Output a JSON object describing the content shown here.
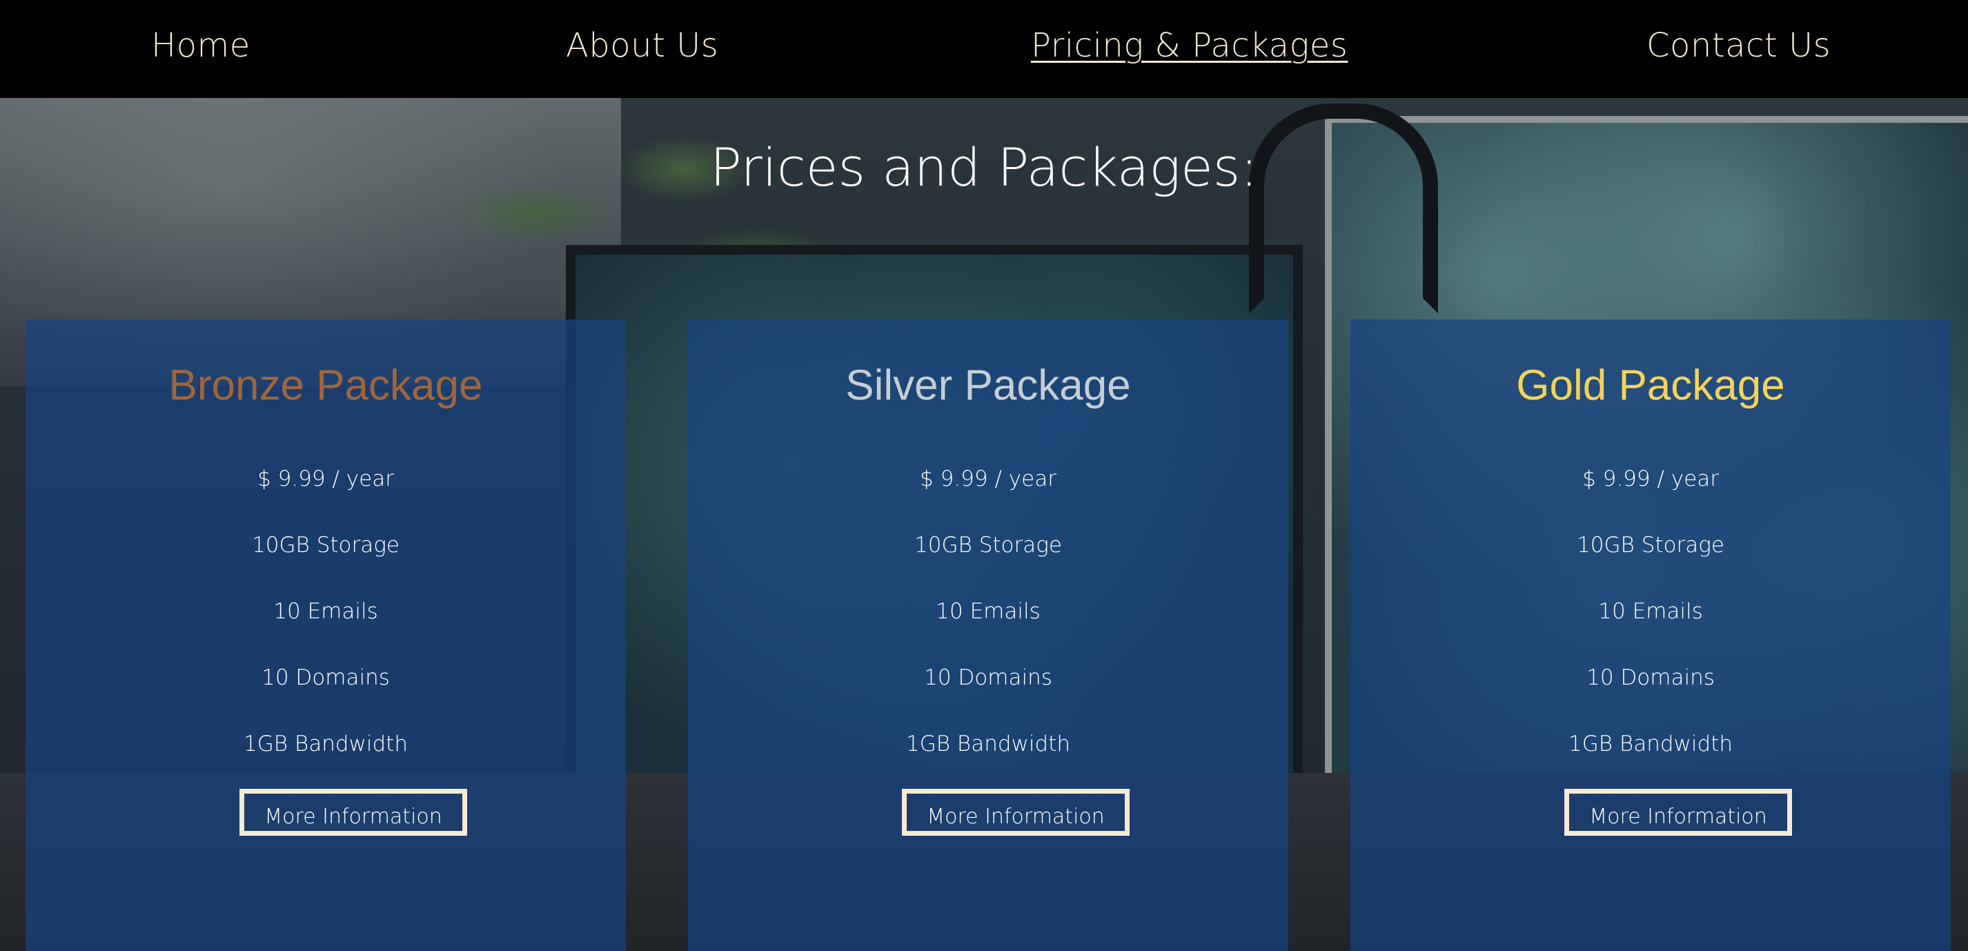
{
  "nav": {
    "items": [
      {
        "label": "Home",
        "active": false
      },
      {
        "label": "About Us",
        "active": false
      },
      {
        "label": "Pricing & Packages",
        "active": true
      },
      {
        "label": "Contact Us",
        "active": false
      }
    ]
  },
  "page": {
    "title": "Prices and Packages:"
  },
  "colors": {
    "nav_text": "#f7ead4",
    "card_bg": "rgba(24,66,130,0.72)",
    "bronze": "#a0663a",
    "silver": "#c7cdd4",
    "gold": "#f3d35a",
    "button_border": "#f7ead4"
  },
  "packages": [
    {
      "name": "Bronze Package",
      "price": "$ 9.99 / year",
      "storage": "10GB Storage",
      "emails": "10 Emails",
      "domains": "10 Domains",
      "bandwidth": "1GB Bandwidth",
      "button": "More Information"
    },
    {
      "name": "Silver Package",
      "price": "$ 9.99 / year",
      "storage": "10GB Storage",
      "emails": "10 Emails",
      "domains": "10 Domains",
      "bandwidth": "1GB Bandwidth",
      "button": "More Information"
    },
    {
      "name": "Gold Package",
      "price": "$ 9.99 / year",
      "storage": "10GB Storage",
      "emails": "10 Emails",
      "domains": "10 Domains",
      "bandwidth": "1GB Bandwidth",
      "button": "More Information"
    }
  ]
}
